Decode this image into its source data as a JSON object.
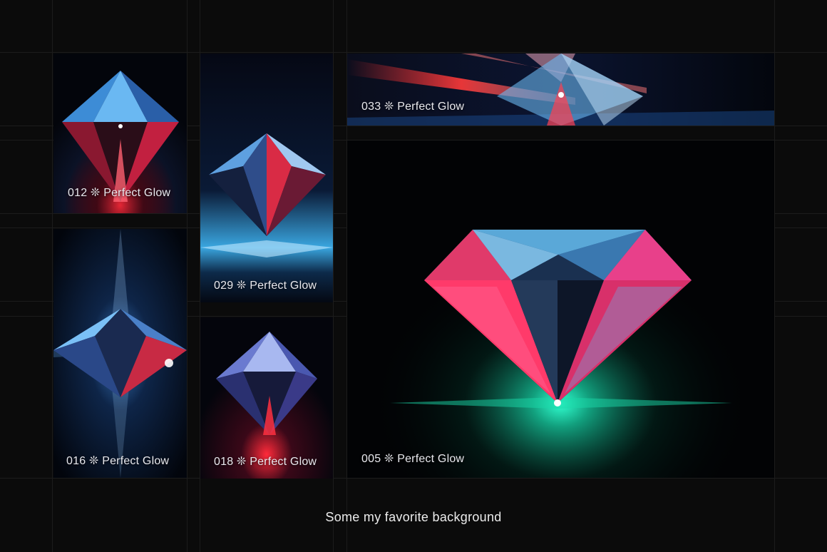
{
  "gallery": {
    "caption": "Some my favorite background",
    "items": [
      {
        "id": "012",
        "label": "012 ❊ Perfect Glow"
      },
      {
        "id": "029",
        "label": "029 ❊ Perfect Glow"
      },
      {
        "id": "033",
        "label": "033 ❊ Perfect Glow"
      },
      {
        "id": "016",
        "label": "016 ❊ Perfect Glow"
      },
      {
        "id": "018",
        "label": "018 ❊ Perfect Glow"
      },
      {
        "id": "005",
        "label": "005 ❊ Perfect Glow"
      }
    ]
  },
  "colors": {
    "background": "#0b0b0b",
    "accent_red": "#ff2d55",
    "accent_blue": "#5ab4ff",
    "accent_teal": "#17e0b0"
  }
}
